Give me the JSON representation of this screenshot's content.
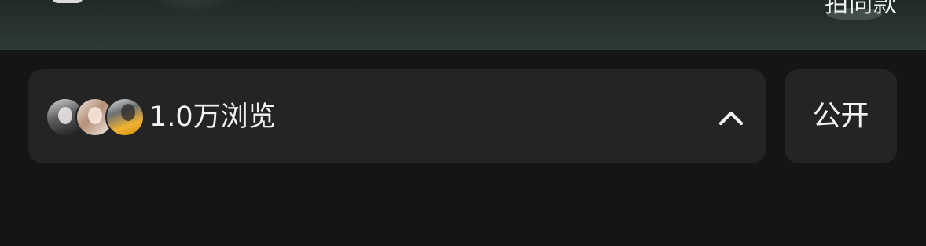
{
  "top_bar": {
    "partial_text": "拍同款",
    "icon": "brand-mark-icon"
  },
  "views": {
    "label": "1.0万浏览",
    "avatar_icons": [
      "avatar-1",
      "avatar-2",
      "avatar-3"
    ],
    "toggle_icon": "chevron-up-icon"
  },
  "visibility": {
    "label": "公开"
  },
  "colors": {
    "background": "#151515",
    "card": "#242424",
    "text": "#f2f2f2",
    "top_band": "#2f3b38"
  }
}
